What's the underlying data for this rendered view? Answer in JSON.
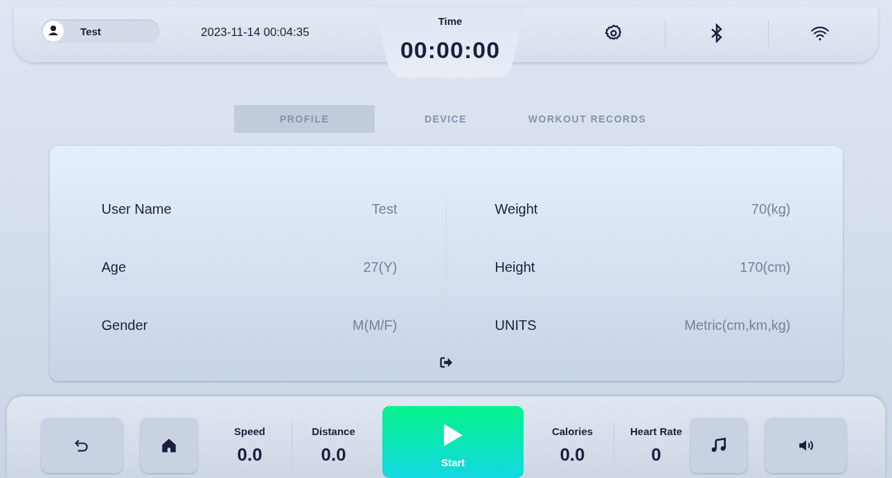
{
  "top_bar": {
    "user": "Test",
    "datetime": "2023-11-14 00:04:35",
    "time_label": "Time",
    "time_value": "00:00:00"
  },
  "tabs": [
    {
      "label": "PROFILE",
      "selected": true
    },
    {
      "label": "DEVICE",
      "selected": false
    },
    {
      "label": "WORKOUT RECORDS",
      "selected": false
    }
  ],
  "profile": {
    "left": [
      {
        "label": "User Name",
        "value": "Test"
      },
      {
        "label": "Age",
        "value": "27(Y)"
      },
      {
        "label": "Gender",
        "value": "M(M/F)"
      }
    ],
    "right": [
      {
        "label": "Weight",
        "value": "70(kg)"
      },
      {
        "label": "Height",
        "value": "170(cm)"
      },
      {
        "label": "UNITS",
        "value": "Metric(cm,km,kg)"
      }
    ]
  },
  "bottom_bar": {
    "left_stats": [
      {
        "label": "Speed",
        "value": "0.0"
      },
      {
        "label": "Distance",
        "value": "0.0"
      }
    ],
    "start": "Start",
    "right_stats": [
      {
        "label": "Calories",
        "value": "0.0"
      },
      {
        "label": "Heart Rate",
        "value": "0"
      }
    ]
  }
}
